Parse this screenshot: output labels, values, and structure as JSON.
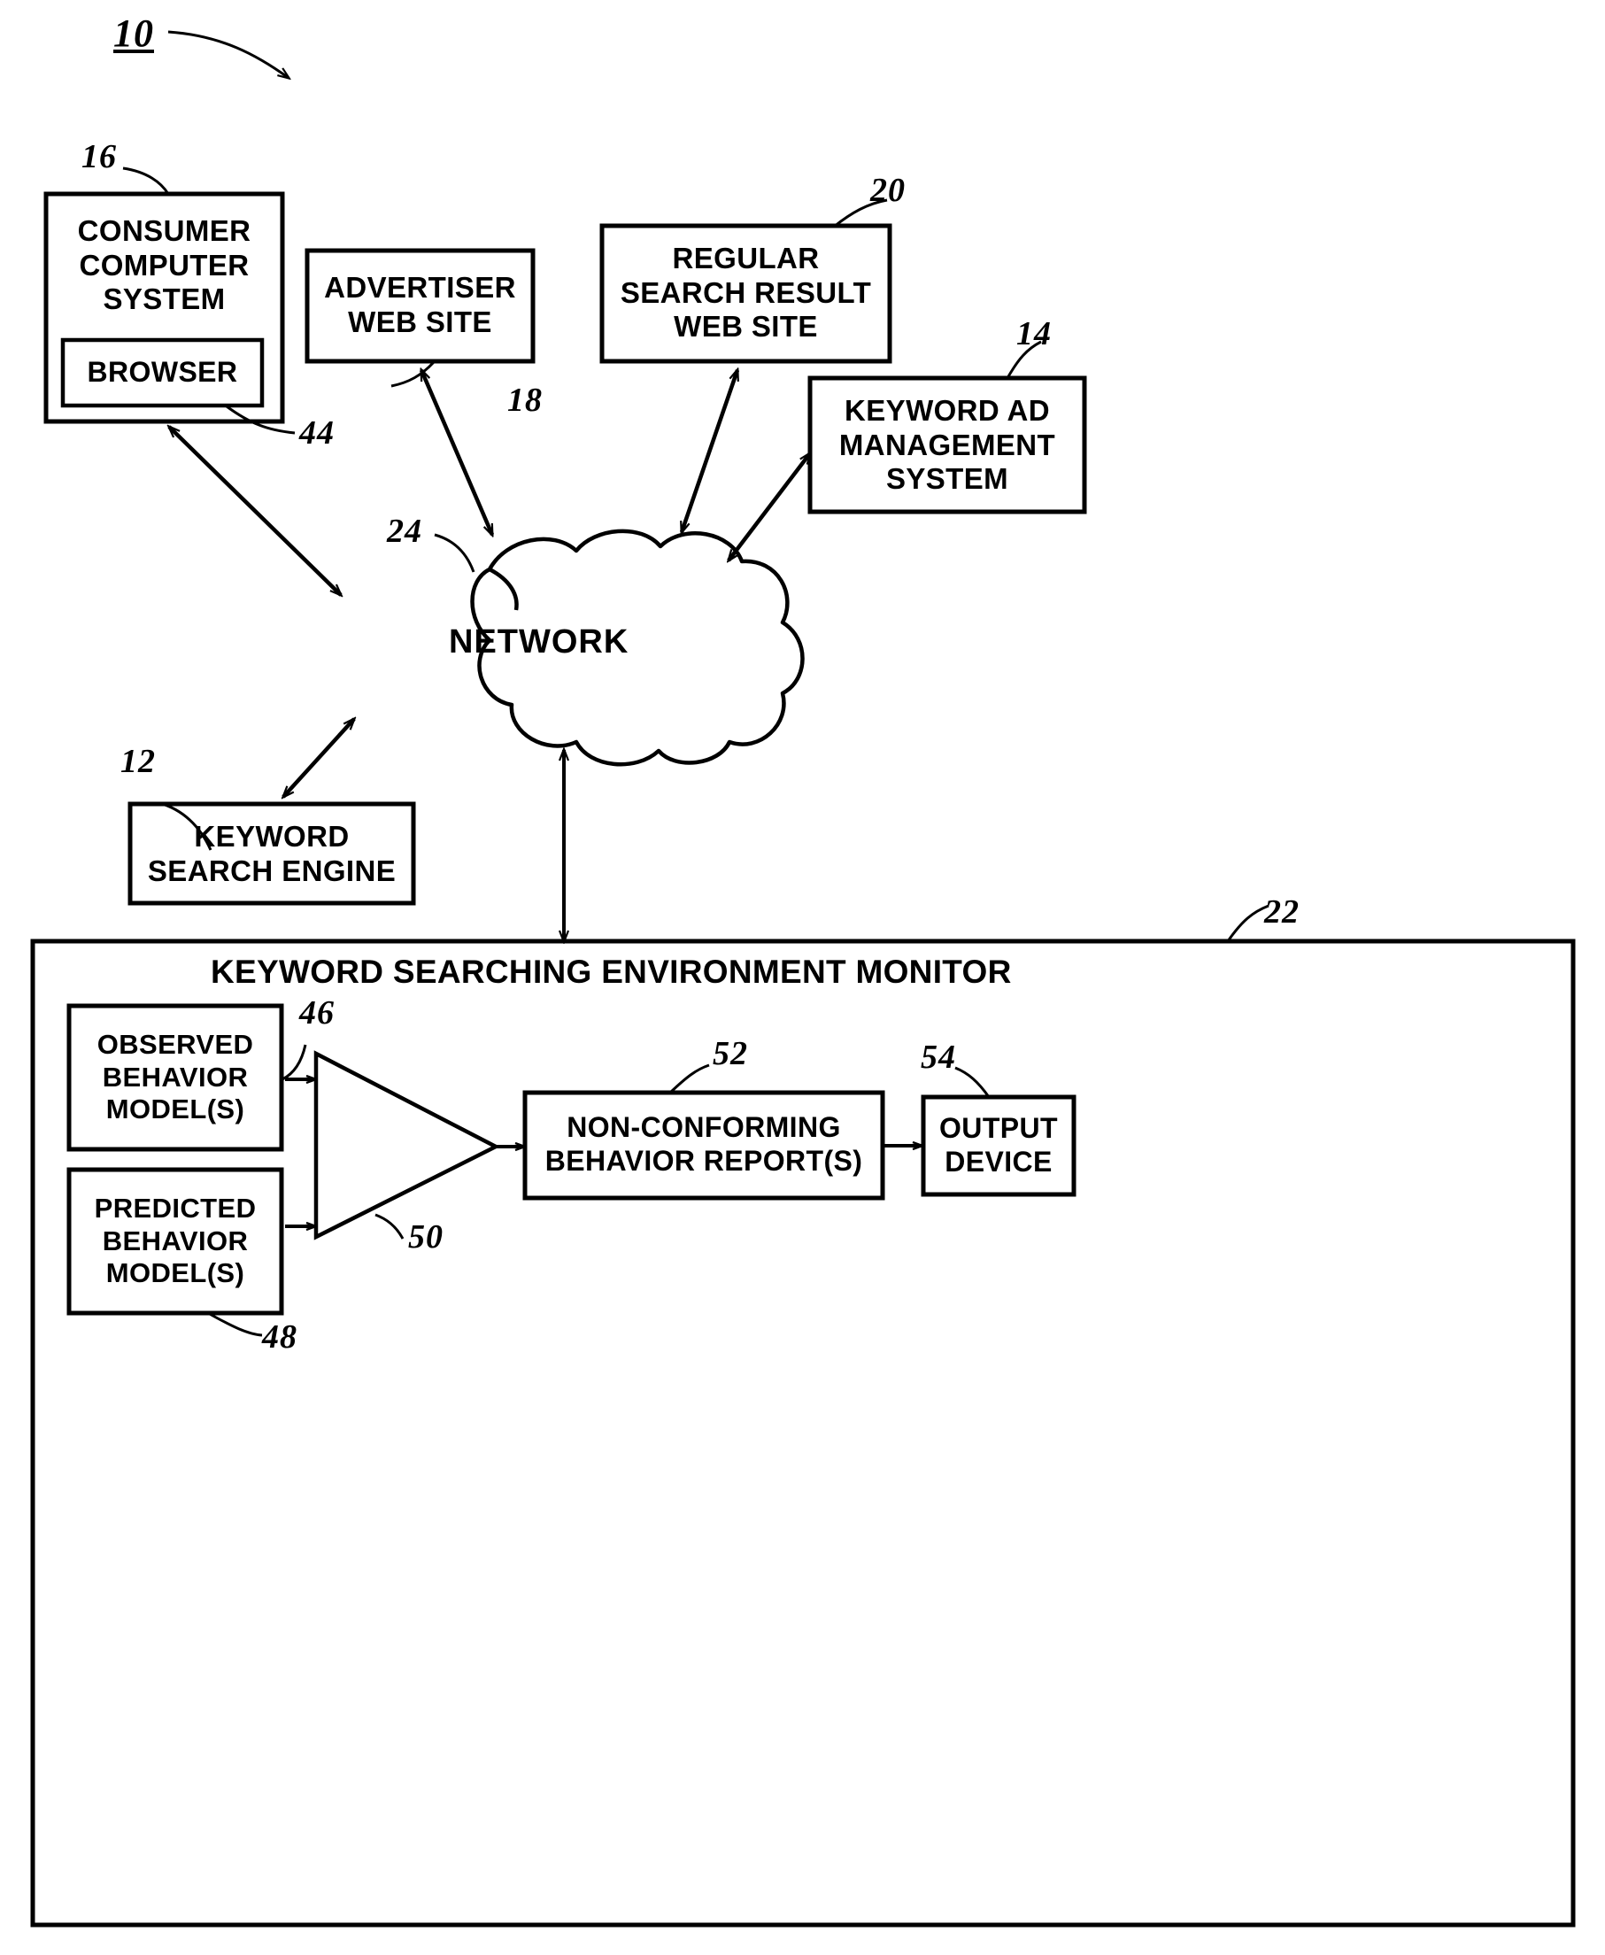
{
  "figure": {
    "number": "10",
    "title": "Keyword searching environment monitoring system"
  },
  "blocks": [
    {
      "id": "consumer-computer-system",
      "ref": "16",
      "lines": [
        "CONSUMER",
        "COMPUTER",
        "SYSTEM"
      ],
      "text": "CONSUMER COMPUTER SYSTEM"
    },
    {
      "id": "browser",
      "ref": "44",
      "lines": [
        "BROWSER"
      ],
      "text": "BROWSER"
    },
    {
      "id": "advertiser-web-site",
      "ref": "18",
      "lines": [
        "ADVERTISER",
        "WEB SITE"
      ],
      "text": "ADVERTISER WEB SITE"
    },
    {
      "id": "regular-search-result-web-site",
      "ref": "20",
      "lines": [
        "REGULAR",
        "SEARCH RESULT",
        "WEB SITE"
      ],
      "text": "REGULAR SEARCH RESULT WEB SITE"
    },
    {
      "id": "keyword-ad-management-system",
      "ref": "14",
      "lines": [
        "KEYWORD AD",
        "MANAGEMENT",
        "SYSTEM"
      ],
      "text": "KEYWORD AD MANAGEMENT SYSTEM"
    },
    {
      "id": "network",
      "ref": "24",
      "lines": [
        "NETWORK"
      ],
      "text": "NETWORK"
    },
    {
      "id": "keyword-search-engine",
      "ref": "12",
      "lines": [
        "KEYWORD",
        "SEARCH ENGINE"
      ],
      "text": "KEYWORD SEARCH ENGINE"
    },
    {
      "id": "keyword-searching-environment-monitor",
      "ref": "22",
      "lines": [
        "KEYWORD SEARCHING ENVIRONMENT MONITOR"
      ],
      "text": "KEYWORD SEARCHING ENVIRONMENT MONITOR"
    },
    {
      "id": "observed-behavior-models",
      "ref": "46",
      "lines": [
        "OBSERVED",
        "BEHAVIOR",
        "MODEL(S)"
      ],
      "text": "OBSERVED BEHAVIOR MODEL(S)"
    },
    {
      "id": "predicted-behavior-models",
      "ref": "48",
      "lines": [
        "PREDICTED",
        "BEHAVIOR",
        "MODEL(S)"
      ],
      "text": "PREDICTED BEHAVIOR MODEL(S)"
    },
    {
      "id": "comparator",
      "ref": "50",
      "lines": [],
      "text": ""
    },
    {
      "id": "non-conforming-behavior-reports",
      "ref": "52",
      "lines": [
        "NON-CONFORMING",
        "BEHAVIOR REPORT(S)"
      ],
      "text": "NON-CONFORMING BEHAVIOR REPORT(S)"
    },
    {
      "id": "output-device",
      "ref": "54",
      "lines": [
        "OUTPUT",
        "DEVICE"
      ],
      "text": "OUTPUT DEVICE"
    }
  ],
  "labels": {
    "fig_10": "10",
    "ref_12": "12",
    "ref_14": "14",
    "ref_16": "16",
    "ref_18": "18",
    "ref_20": "20",
    "ref_22": "22",
    "ref_24": "24",
    "ref_44": "44",
    "ref_46": "46",
    "ref_48": "48",
    "ref_50": "50",
    "ref_52": "52",
    "ref_54": "54"
  },
  "text": {
    "consumer_l1": "CONSUMER",
    "consumer_l2": "COMPUTER",
    "consumer_l3": "SYSTEM",
    "browser": "BROWSER",
    "advertiser_l1": "ADVERTISER",
    "advertiser_l2": "WEB SITE",
    "regular_l1": "REGULAR",
    "regular_l2": "SEARCH RESULT",
    "regular_l3": "WEB SITE",
    "kwad_l1": "KEYWORD AD",
    "kwad_l2": "MANAGEMENT",
    "kwad_l3": "SYSTEM",
    "network": "NETWORK",
    "kse_l1": "KEYWORD",
    "kse_l2": "SEARCH ENGINE",
    "monitor_title": "KEYWORD SEARCHING ENVIRONMENT MONITOR",
    "observed_l1": "OBSERVED",
    "observed_l2": "BEHAVIOR",
    "observed_l3": "MODEL(S)",
    "predicted_l1": "PREDICTED",
    "predicted_l2": "BEHAVIOR",
    "predicted_l3": "MODEL(S)",
    "ncbr_l1": "NON-CONFORMING",
    "ncbr_l2": "BEHAVIOR REPORT(S)",
    "output_l1": "OUTPUT",
    "output_l2": "DEVICE"
  },
  "colors": {
    "ink": "#000000",
    "paper": "#ffffff"
  }
}
